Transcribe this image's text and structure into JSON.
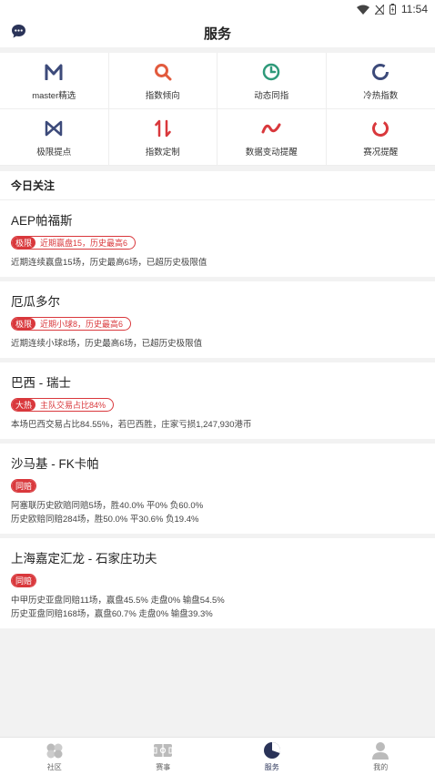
{
  "status_bar": {
    "time": "11:54"
  },
  "header": {
    "title": "服务"
  },
  "services": [
    {
      "label": "master精选",
      "icon": "m-letter-icon",
      "color": "#3c4a7a"
    },
    {
      "label": "指数倾向",
      "icon": "magnifier-icon",
      "color": "#e25b3e"
    },
    {
      "label": "动态同指",
      "icon": "clock-icon",
      "color": "#2f9a7a"
    },
    {
      "label": "冷热指数",
      "icon": "ring-icon",
      "color": "#3c4a7a"
    },
    {
      "label": "极限提点",
      "icon": "bowtie-icon",
      "color": "#3c4a7a"
    },
    {
      "label": "指数定制",
      "icon": "sort-arrows-icon",
      "color": "#d9383c"
    },
    {
      "label": "数据变动提醒",
      "icon": "wave-icon",
      "color": "#d9383c"
    },
    {
      "label": "赛况提醒",
      "icon": "partial-ring-icon",
      "color": "#d9383c"
    }
  ],
  "section": {
    "title": "今日关注"
  },
  "matches": [
    {
      "name": "AEP帕福斯",
      "tag_type": "极限",
      "tag_text": "近期赢盘15，历史最高6",
      "lines": [
        "近期连续赢盘15场，历史最高6场，已超历史极限值"
      ]
    },
    {
      "name": "厄瓜多尔",
      "tag_type": "极限",
      "tag_text": "近期小球8，历史最高6",
      "lines": [
        "近期连续小球8场，历史最高6场，已超历史极限值"
      ]
    },
    {
      "name": "巴西 - 瑞士",
      "tag_type": "大热",
      "tag_text": "主队交易占比84%",
      "lines": [
        "本场巴西交易占比84.55%，若巴西胜，庄家亏损1,247,930港币"
      ]
    },
    {
      "name": "沙马基 - FK卡帕",
      "tag_type": "同赔",
      "tag_text": "",
      "lines": [
        "阿塞联历史欧赔同赔5场，胜40.0%  平0%  负60.0%",
        "历史欧赔同赔284场，胜50.0%  平30.6%  负19.4%"
      ]
    },
    {
      "name": "上海嘉定汇龙 - 石家庄功夫",
      "tag_type": "同赔",
      "tag_text": "",
      "lines": [
        "中甲历史亚盘同赔11场，赢盘45.5%  走盘0%  输盘54.5%",
        "历史亚盘同赔168场，赢盘60.7%  走盘0%  输盘39.3%"
      ]
    }
  ],
  "nav": [
    {
      "label": "社区",
      "icon": "community-icon"
    },
    {
      "label": "赛事",
      "icon": "pitch-icon"
    },
    {
      "label": "服务",
      "icon": "service-icon",
      "active": true
    },
    {
      "label": "我的",
      "icon": "profile-icon"
    }
  ],
  "colors": {
    "accent": "#d9383c",
    "navy": "#2a3358",
    "background": "#f2f2f2"
  }
}
